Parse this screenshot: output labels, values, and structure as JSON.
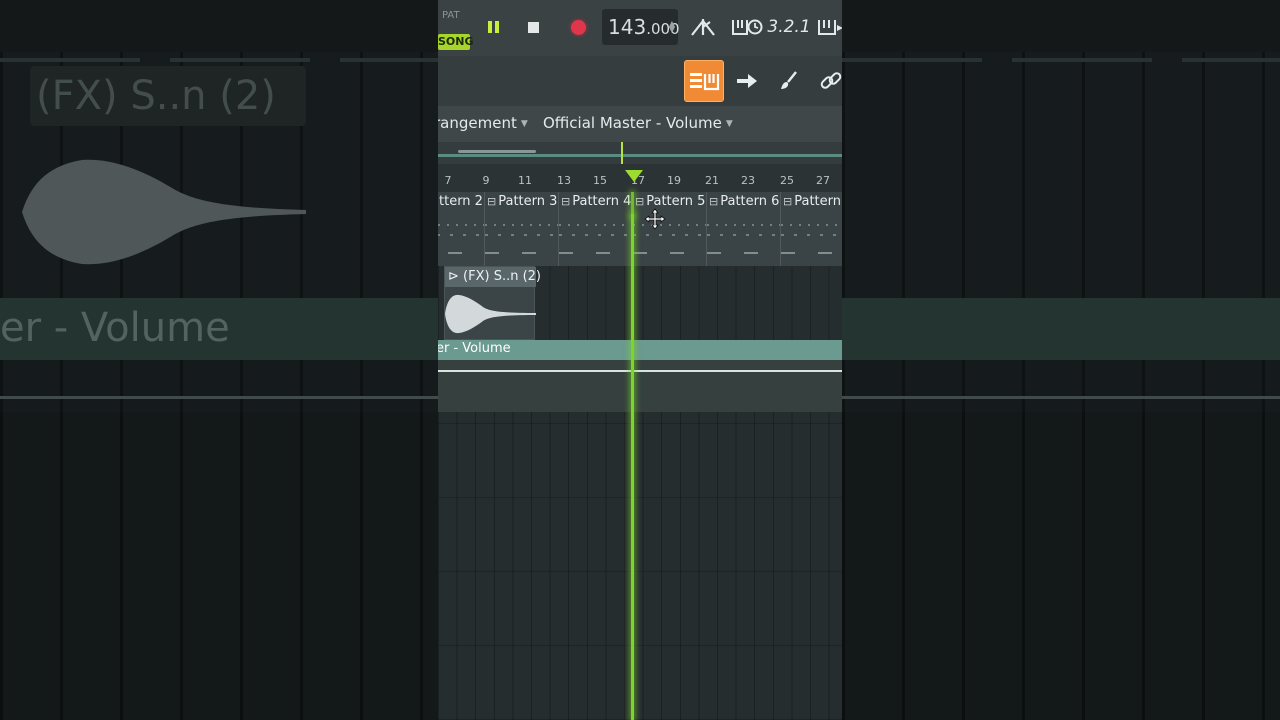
{
  "transport": {
    "pat_label": "PAT",
    "song_label": "SONG",
    "tempo_int": "143",
    "tempo_dec": ".000",
    "countdown_label": "3.2.1"
  },
  "header": {
    "left_text": "rangement",
    "right_text": "Official Master - Volume"
  },
  "ruler": {
    "ticks": [
      "7",
      "9",
      "11",
      "13",
      "15",
      "17",
      "19",
      "21",
      "23",
      "25",
      "27"
    ]
  },
  "patterns": [
    {
      "label": "ttern 2"
    },
    {
      "label": "Pattern 3"
    },
    {
      "label": "Pattern 4"
    },
    {
      "label": "Pattern 5"
    },
    {
      "label": "Pattern 6"
    },
    {
      "label": "Pattern"
    }
  ],
  "audio_clip": {
    "title": "(FX) S..n (2)"
  },
  "automation_clip": {
    "label": "er - Volume"
  },
  "background": {
    "blur_title": "(FX) S..n (2)",
    "blur_volume": "er - Volume"
  },
  "colors": {
    "accent_green": "#7cd62a",
    "record_red": "#e0364b",
    "playlist_orange": "#f08a34",
    "automation_teal": "#6a9a90"
  },
  "icons": [
    "pause-icon",
    "stop-icon",
    "record-icon",
    "metronome-icon",
    "wait-input-icon",
    "countdown-icon",
    "typing-keyboard-icon",
    "playlist-icon",
    "next-arrow-icon",
    "brush-icon",
    "link-icon",
    "move-cursor-icon"
  ]
}
